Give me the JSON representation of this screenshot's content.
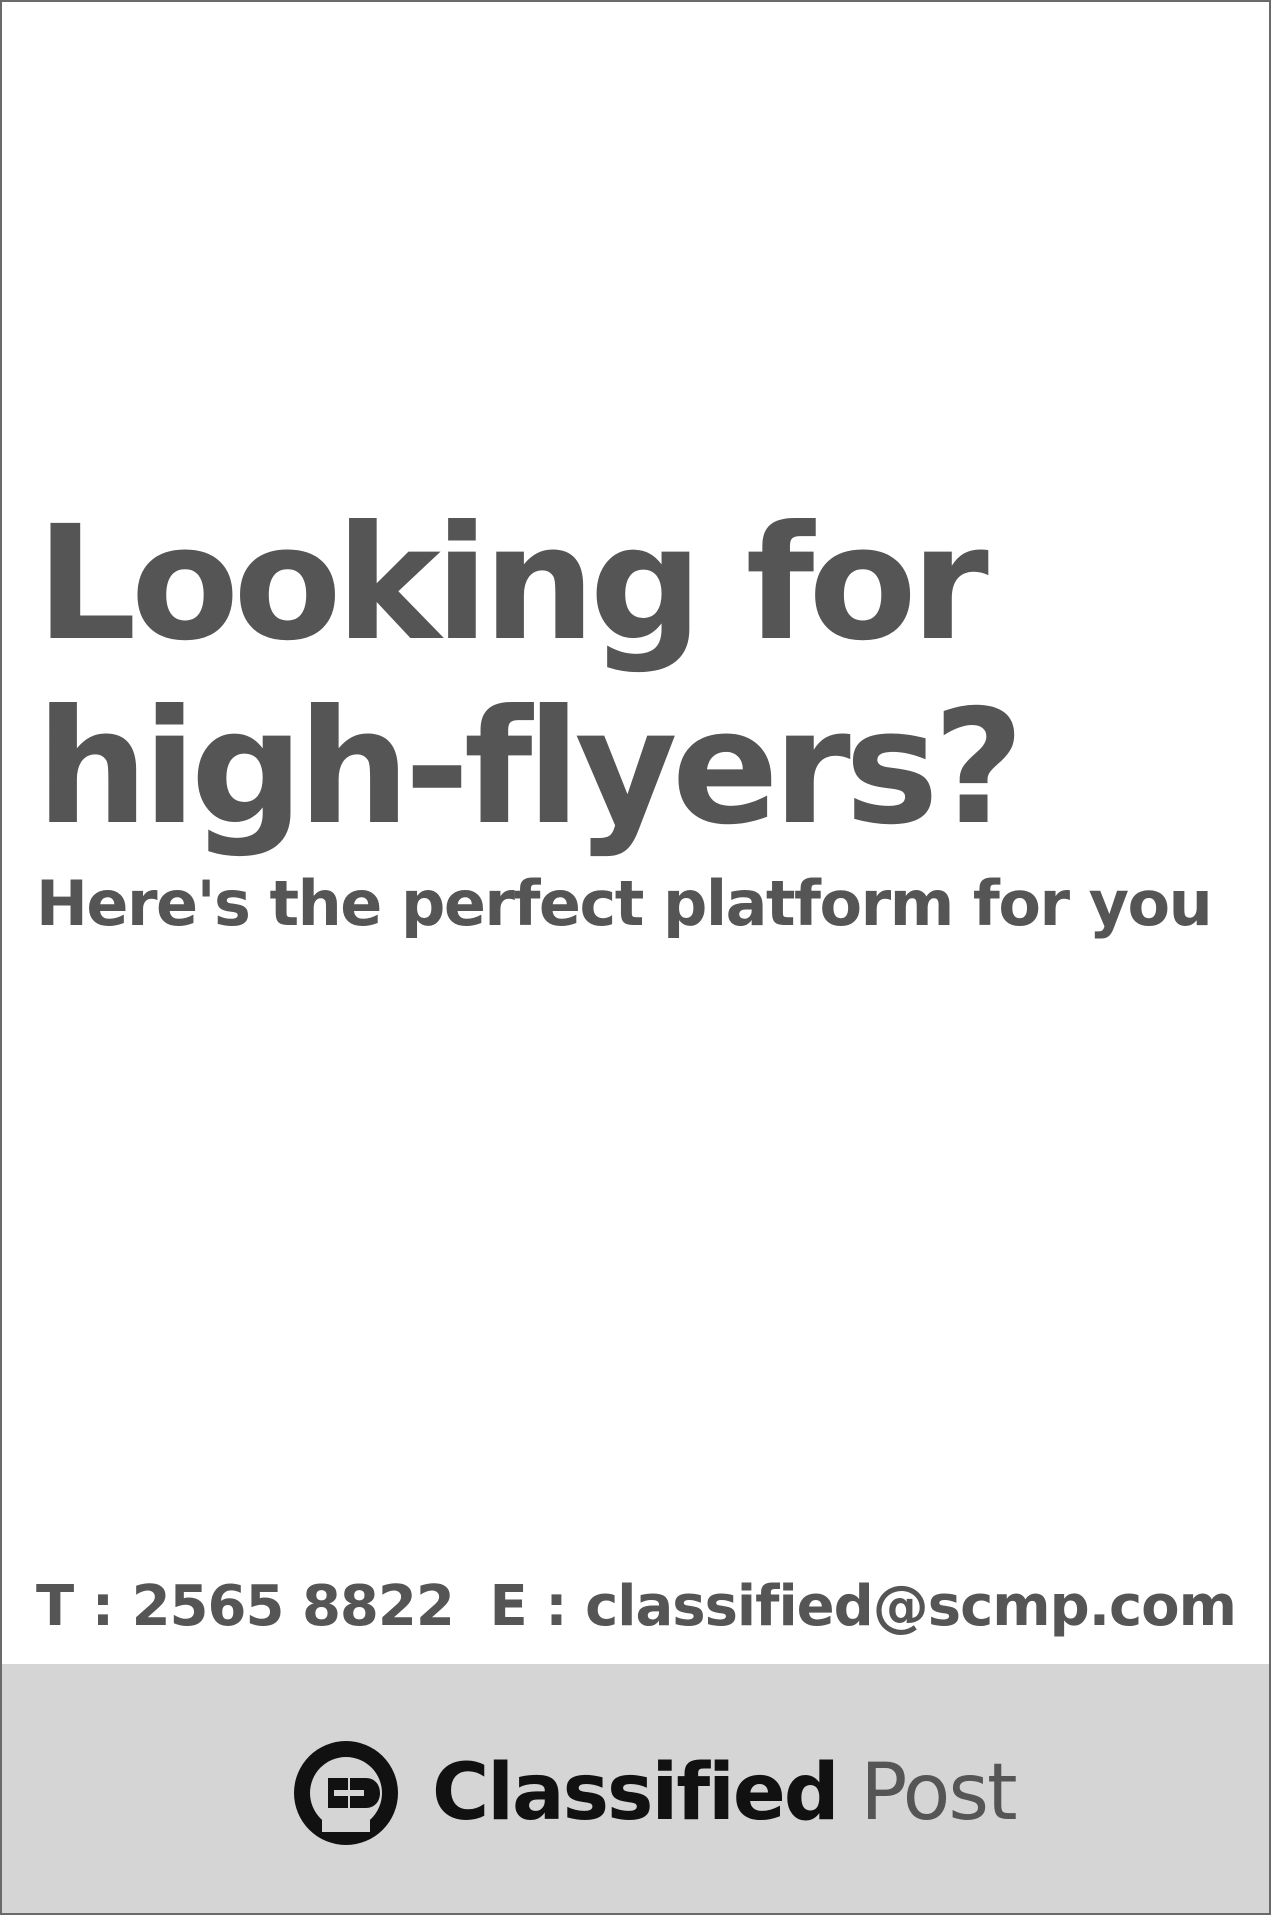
{
  "headline": {
    "line1": "Looking for",
    "line2": "high-flyers?"
  },
  "subheadline": "Here's the perfect platform for you",
  "contact": {
    "phone": "T : 2565 8822",
    "email": "E : classified@scmp.com"
  },
  "brand": {
    "icon": "classified-post-logo-icon",
    "name_part1": "Classified",
    "name_part2": "Post"
  },
  "colors": {
    "text_gray": "#555555",
    "footer_band": "#d5d5d5",
    "logo_black": "#111111"
  }
}
